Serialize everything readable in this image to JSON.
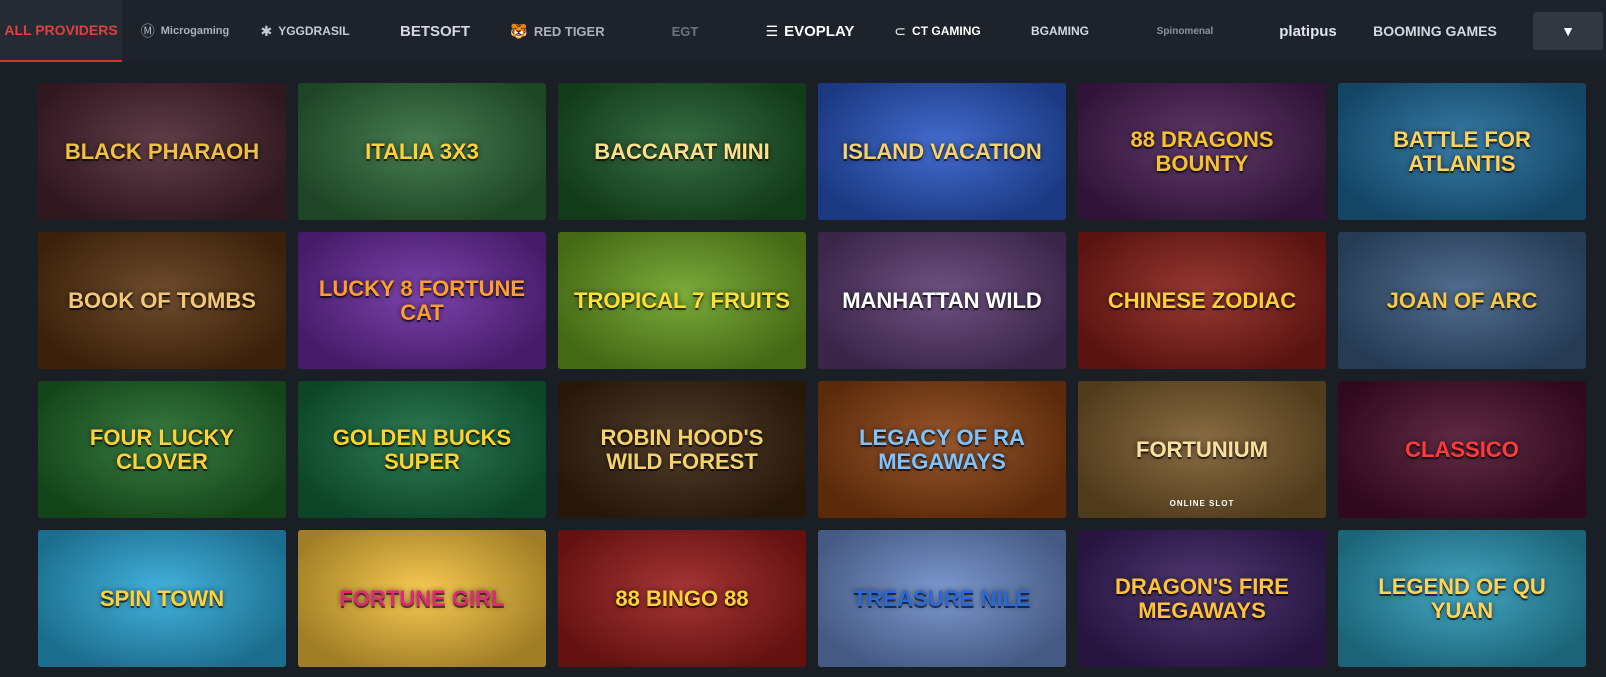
{
  "providers": [
    {
      "label": "ALL PROVIDERS",
      "active": true,
      "icon": ""
    },
    {
      "label": "Microgaming",
      "icon": "Ⓜ"
    },
    {
      "label": "YGGDRASIL",
      "icon": "✱"
    },
    {
      "label": "BETSOFT",
      "icon": ""
    },
    {
      "label": "RED TIGER",
      "icon": "🐯"
    },
    {
      "label": "EGT",
      "icon": ""
    },
    {
      "label": "EVOPLAY",
      "icon": "☰"
    },
    {
      "label": "CT GAMING",
      "icon": "⊂"
    },
    {
      "label": "BGAMING",
      "icon": ""
    },
    {
      "label": "Spinomenal",
      "icon": ""
    },
    {
      "label": "platipus",
      "icon": ""
    },
    {
      "label": "BOOMING GAMES",
      "icon": ""
    }
  ],
  "dropdown": {
    "icon": "chevron-down-icon",
    "glyph": "▼"
  },
  "games": [
    {
      "title": "Black Pharaoh",
      "bg": "#4a2430",
      "fg": "#f0c040"
    },
    {
      "title": "Italia 3x3",
      "bg": "#2e6b3a",
      "fg": "#ffd23a"
    },
    {
      "title": "Baccarat Mini",
      "bg": "#1c5a2a",
      "fg": "#ffe08a"
    },
    {
      "title": "Island Vacation",
      "bg": "#2a58c8",
      "fg": "#f7d36a"
    },
    {
      "title": "88 Dragons Bounty",
      "bg": "#4a1f55",
      "fg": "#f6c230"
    },
    {
      "title": "Battle for Atlantis",
      "bg": "#1d6a9a",
      "fg": "#ffd35a"
    },
    {
      "title": "Book of Tombs",
      "bg": "#5a3310",
      "fg": "#f1c77a"
    },
    {
      "title": "Lucky 8 Fortune Cat",
      "bg": "#6a2aa0",
      "fg": "#ff9f2a"
    },
    {
      "title": "Tropical 7 Fruits",
      "bg": "#6aa020",
      "fg": "#ffe03a"
    },
    {
      "title": "Manhattan Wild",
      "bg": "#5a3a70",
      "fg": "#ffffff"
    },
    {
      "title": "Chinese Zodiac",
      "bg": "#8a1e18",
      "fg": "#ffcf3a"
    },
    {
      "title": "Joan of Arc",
      "bg": "#3a5a80",
      "fg": "#f6c84a"
    },
    {
      "title": "Four Lucky Clover",
      "bg": "#1f6a28",
      "fg": "#ffd23a"
    },
    {
      "title": "Golden Bucks Super",
      "bg": "#136a3e",
      "fg": "#ffd42a"
    },
    {
      "title": "Robin Hood's Wild Forest",
      "bg": "#3a2410",
      "fg": "#f5d36a"
    },
    {
      "title": "Legacy of Ra Megaways",
      "bg": "#8a4010",
      "fg": "#7ec2ff"
    },
    {
      "title": "Fortunium",
      "bg": "#7a5a2a",
      "fg": "#f8e0a0",
      "sub": "ONLINE SLOT"
    },
    {
      "title": "Classico",
      "bg": "#4a0e2a",
      "fg": "#ff3a3a"
    },
    {
      "title": "Spin Town",
      "bg": "#2aa8d8",
      "fg": "#ffd23a"
    },
    {
      "title": "Fortune Girl",
      "bg": "#f6c23a",
      "fg": "#e0287a"
    },
    {
      "title": "88 Bingo 88",
      "bg": "#9a1a1a",
      "fg": "#ffd23a"
    },
    {
      "title": "Treasure Nile",
      "bg": "#6a8ac8",
      "fg": "#2a6ad8"
    },
    {
      "title": "Dragon's Fire Megaways",
      "bg": "#3a1f60",
      "fg": "#ffc23a"
    },
    {
      "title": "Legend of Qu Yuan",
      "bg": "#2a9ab8",
      "fg": "#ffd35a"
    }
  ]
}
